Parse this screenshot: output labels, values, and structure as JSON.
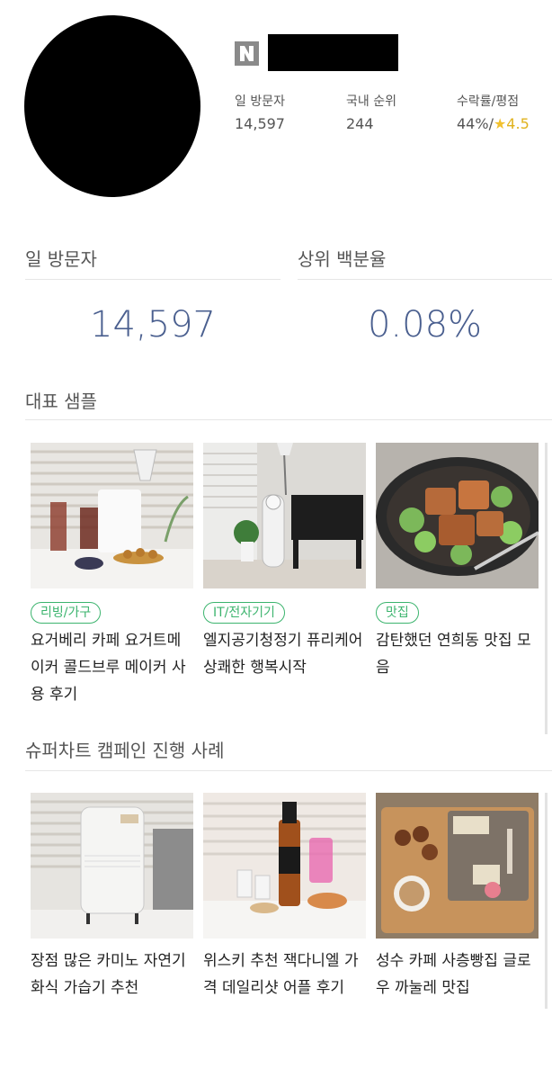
{
  "profile": {
    "logo_letter": "N",
    "stats": [
      {
        "label": "일 방문자",
        "value": "14,597"
      },
      {
        "label": "국내 순위",
        "value": "244"
      },
      {
        "label": "수락률/평점",
        "value_prefix": "44%/",
        "star": "★",
        "rating": "4.5"
      }
    ]
  },
  "metrics": {
    "visitors": {
      "label": "일 방문자",
      "value": "14,597"
    },
    "percentile": {
      "label": "상위 백분율",
      "value": "0.08%"
    }
  },
  "samples": {
    "title": "대표 샘플",
    "items": [
      {
        "tag": "리빙/가구",
        "title": "요거베리 카페 요거트메이커 콜드브루 메이커 사용 후기"
      },
      {
        "tag": "IT/전자기기",
        "title": "엘지공기청정기 퓨리케어 상쾌한 행복시작"
      },
      {
        "tag": "맛집",
        "title": "감탄했던 연희동 맛집 모음"
      }
    ]
  },
  "campaigns": {
    "title": "슈퍼차트 캠페인 진행 사례",
    "items": [
      {
        "title": "장점 많은 카미노 자연기화식 가습기 추천"
      },
      {
        "title": "위스키 추천 잭다니엘 가격 데일리샷 어플 후기"
      },
      {
        "title": "성수 카페 사층빵집 글로우 까눌레 맛집"
      }
    ]
  },
  "colors": {
    "accent_number": "#4a5f8f",
    "tag_green": "#3cb46e",
    "star": "#f2c12e"
  }
}
